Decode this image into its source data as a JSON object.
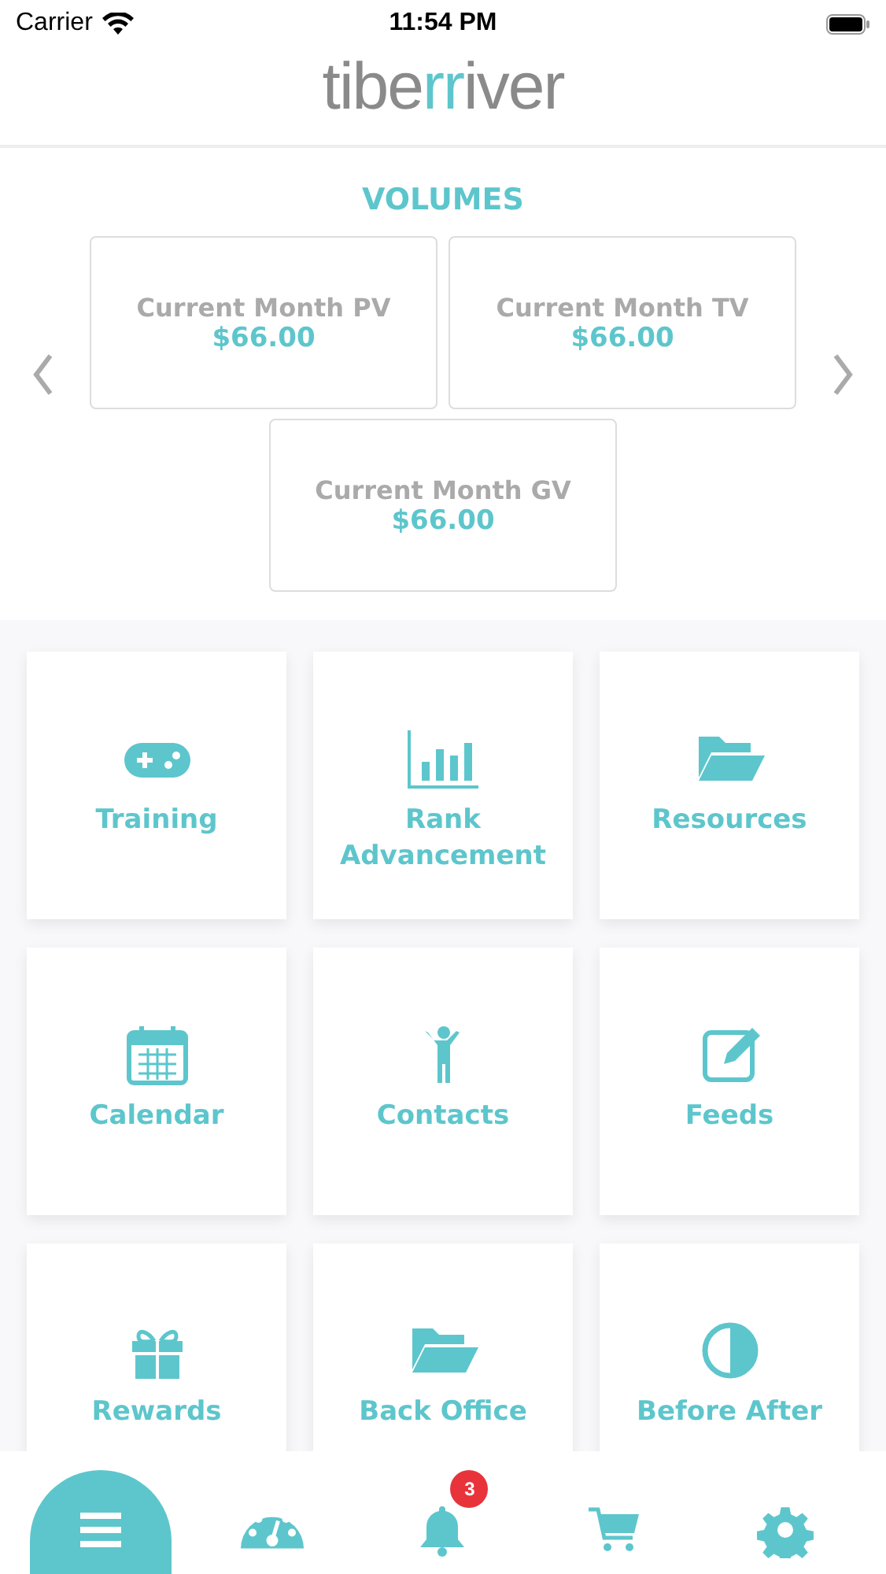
{
  "status_bar": {
    "carrier": "Carrier",
    "time": "11:54 PM"
  },
  "logo": {
    "start": "tibe",
    "accent": "rr",
    "end": "iver"
  },
  "volumes": {
    "title": "VOLUMES",
    "cards": [
      {
        "label": "Current Month PV",
        "value": "$66.00"
      },
      {
        "label": "Current Month TV",
        "value": "$66.00"
      },
      {
        "label": "Current Month GV",
        "value": "$66.00"
      }
    ]
  },
  "tiles": [
    {
      "label": "Training"
    },
    {
      "label": "Rank Advancement"
    },
    {
      "label": "Resources"
    },
    {
      "label": "Calendar"
    },
    {
      "label": "Contacts"
    },
    {
      "label": "Feeds"
    },
    {
      "label": "Rewards"
    },
    {
      "label": "Back Office"
    },
    {
      "label": "Before After"
    }
  ],
  "tab_bar": [
    {
      "kind": "menu",
      "selected": true
    },
    {
      "kind": "dashboard",
      "selected": false
    },
    {
      "kind": "notifications",
      "selected": false,
      "badge": "3"
    },
    {
      "kind": "cart",
      "selected": false
    },
    {
      "kind": "settings",
      "selected": false
    }
  ]
}
